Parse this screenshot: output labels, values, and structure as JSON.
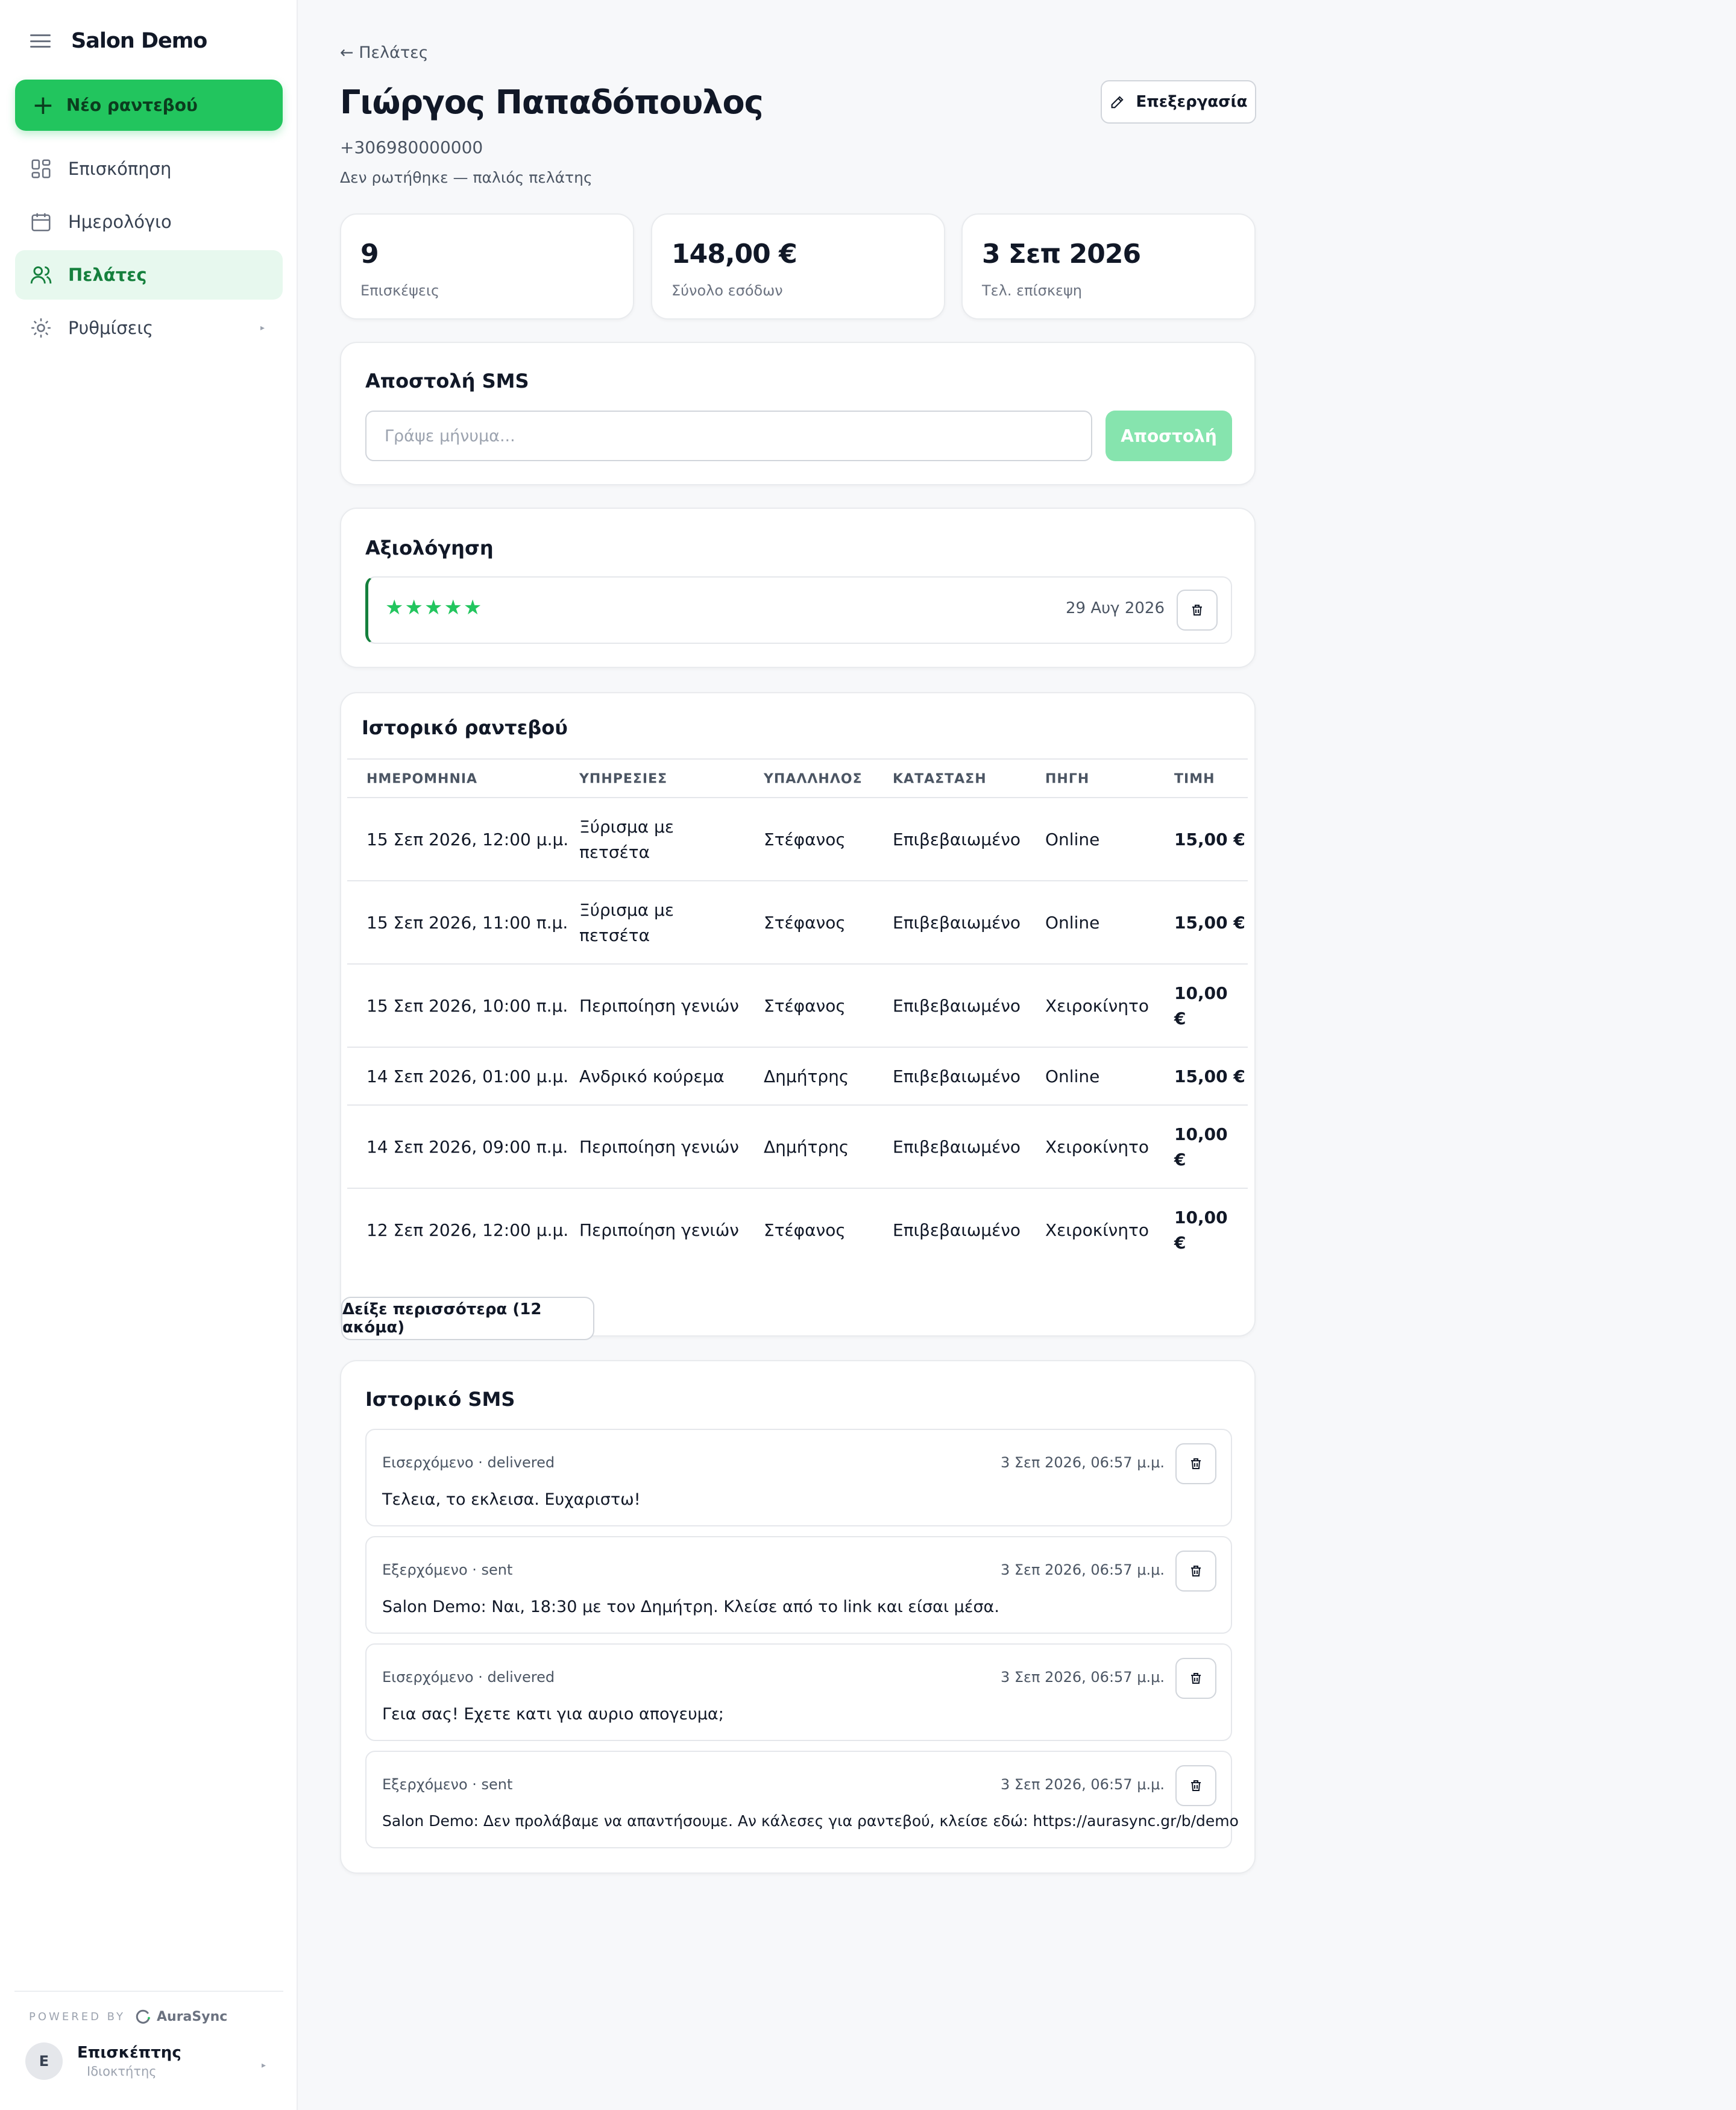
{
  "sidebar": {
    "brand": "Salon Demo",
    "new_appointment": "Νέο ραντεβού",
    "items": [
      {
        "label": "Επισκόπηση",
        "icon": "dashboard-icon"
      },
      {
        "label": "Ημερολόγιο",
        "icon": "calendar-icon"
      },
      {
        "label": "Πελάτες",
        "icon": "users-icon",
        "active": true
      },
      {
        "label": "Ρυθμίσεις",
        "icon": "settings-icon"
      }
    ],
    "powered_by": "POWERED BY",
    "powered_logo": "AuraSync",
    "user": {
      "initial": "Ε",
      "name": "Επισκέπτης",
      "role": "Ιδιοκτήτης"
    }
  },
  "header": {
    "back": "← Πελάτες",
    "name": "Γιώργος Παπαδόπουλος",
    "phone": "+306980000000",
    "subtitle": "Δεν ρωτήθηκε — παλιός πελάτης",
    "edit": "Επεξεργασία"
  },
  "stats": [
    {
      "value": "9",
      "label": "Επισκέψεις"
    },
    {
      "value": "148,00 €",
      "label": "Σύνολο εσόδων"
    },
    {
      "value": "3 Σεπ 2026",
      "label": "Τελ. επίσκεψη"
    }
  ],
  "sms_send": {
    "title": "Αποστολή SMS",
    "placeholder": "Γράψε μήνυμα...",
    "button": "Αποστολή"
  },
  "review": {
    "title": "Αξιολόγηση",
    "stars": "★★★★★",
    "rating": 5,
    "date": "29 Αυγ 2026"
  },
  "history": {
    "title": "Ιστορικό ραντεβού",
    "columns": [
      "ΗΜΕΡΟΜΗΝΙΑ",
      "ΥΠΗΡΕΣΙΕΣ",
      "ΥΠΑΛΛΗΛΟΣ",
      "ΚΑΤΑΣΤΑΣΗ",
      "ΠΗΓΗ",
      "ΤΙΜΗ"
    ],
    "rows": [
      {
        "date": "15 Σεπ 2026, 12:00 μ.μ.",
        "service": "Ξύρισμα με πετσέτα",
        "staff": "Στέφανος",
        "status": "Επιβεβαιωμένο",
        "source": "Online",
        "price": "15,00 €"
      },
      {
        "date": "15 Σεπ 2026, 11:00 π.μ.",
        "service": "Ξύρισμα με πετσέτα",
        "staff": "Στέφανος",
        "status": "Επιβεβαιωμένο",
        "source": "Online",
        "price": "15,00 €"
      },
      {
        "date": "15 Σεπ 2026, 10:00 π.μ.",
        "service": "Περιποίηση γενιών",
        "staff": "Στέφανος",
        "status": "Επιβεβαιωμένο",
        "source": "Χειροκίνητο",
        "price": "10,00 €"
      },
      {
        "date": "14 Σεπ 2026, 01:00 μ.μ.",
        "service": "Ανδρικό κούρεμα",
        "staff": "Δημήτρης",
        "status": "Επιβεβαιωμένο",
        "source": "Online",
        "price": "15,00 €"
      },
      {
        "date": "14 Σεπ 2026, 09:00 π.μ.",
        "service": "Περιποίηση γενιών",
        "staff": "Δημήτρης",
        "status": "Επιβεβαιωμένο",
        "source": "Χειροκίνητο",
        "price": "10,00 €"
      },
      {
        "date": "12 Σεπ 2026, 12:00 μ.μ.",
        "service": "Περιποίηση γενιών",
        "staff": "Στέφανος",
        "status": "Επιβεβαιωμένο",
        "source": "Χειροκίνητο",
        "price": "10,00 €"
      }
    ],
    "more": "Δείξε περισσότερα (12 ακόμα)"
  },
  "sms_history": {
    "title": "Ιστορικό SMS",
    "messages": [
      {
        "meta": "Εισερχόμενο · delivered",
        "time": "3 Σεπ 2026, 06:57 μ.μ.",
        "body": "Τελεια, το εκλεισα. Ευχαριστω!"
      },
      {
        "meta": "Εξερχόμενο · sent",
        "time": "3 Σεπ 2026, 06:57 μ.μ.",
        "body": "Salon Demo: Ναι, 18:30 με τον Δημήτρη. Κλείσε από το link και είσαι μέσα."
      },
      {
        "meta": "Εισερχόμενο · delivered",
        "time": "3 Σεπ 2026, 06:57 μ.μ.",
        "body": "Γεια σας! Εχετε κατι για αυριο απογευμα;"
      },
      {
        "meta": "Εξερχόμενο · sent",
        "time": "3 Σεπ 2026, 06:57 μ.μ.",
        "body": "Salon Demo: Δεν προλάβαμε να απαντήσουμε. Αν κάλεσες για ραντεβού, κλείσε εδώ: https://aurasync.gr/b/demo"
      }
    ]
  },
  "colors": {
    "accent": "#22c55e",
    "accent_dark": "#15803d",
    "active_bg": "#e7f8ee",
    "page_bg": "#f7f8fa"
  }
}
